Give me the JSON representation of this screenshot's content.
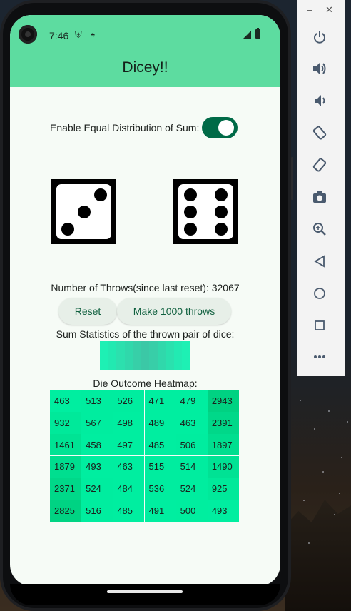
{
  "status_bar": {
    "time": "7:46"
  },
  "app": {
    "title": "Dicey!!"
  },
  "toggle": {
    "label": "Enable Equal Distribution of Sum:",
    "on": true
  },
  "dice": [
    {
      "value": 3
    },
    {
      "value": 6
    }
  ],
  "throws": {
    "label": "Number of Throws(since last reset): 32067"
  },
  "buttons": {
    "reset": "Reset",
    "make": "Make 1000 throws"
  },
  "sum_stats": {
    "label": "Sum Statistics of the thrown pair of dice:"
  },
  "heatmap": {
    "label": "Die Outcome Heatmap:",
    "rows": [
      [
        "463",
        "513",
        "526",
        "471",
        "479",
        "2943"
      ],
      [
        "932",
        "567",
        "498",
        "489",
        "463",
        "2391"
      ],
      [
        "1461",
        "458",
        "497",
        "485",
        "506",
        "1897"
      ],
      [
        "1879",
        "493",
        "463",
        "515",
        "514",
        "1490"
      ],
      [
        "2371",
        "524",
        "484",
        "536",
        "524",
        "925"
      ],
      [
        "2825",
        "516",
        "485",
        "491",
        "500",
        "493"
      ]
    ]
  },
  "colors": {
    "appbar": "#5ddca0",
    "switch": "#006a47",
    "button_text": "#10603f",
    "heat": "#00e89a"
  },
  "toolbar_icons": [
    "power-icon",
    "volume-up-icon",
    "volume-down-icon",
    "rotate-left-icon",
    "rotate-right-icon",
    "camera-icon",
    "zoom-icon",
    "back-icon",
    "home-icon",
    "overview-icon",
    "more-icon"
  ]
}
